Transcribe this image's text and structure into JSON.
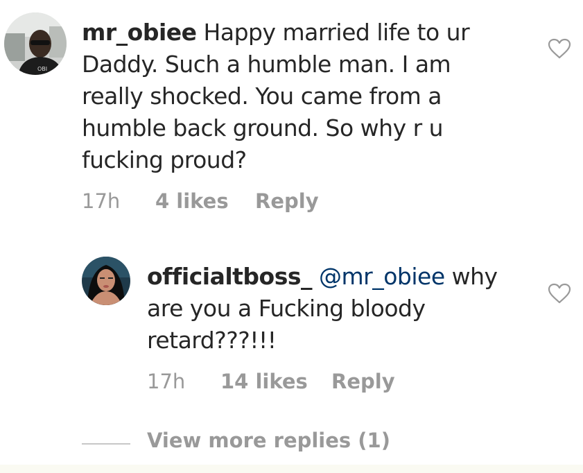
{
  "comments": [
    {
      "username": "mr_obiee",
      "text_lines": [
        "Happy married life to ur",
        "Daddy. Such a humble man. I am",
        "really shocked. You came from a",
        "humble back ground. So why r u",
        "fucking proud?"
      ],
      "time": "17h",
      "likes": "4 likes",
      "reply_label": "Reply",
      "avatar_icon": "profile-photo-man-sunglasses",
      "heart_icon": "heart-outline-icon"
    },
    {
      "username": "officialtboss_",
      "mention": "@mr_obiee",
      "text_lines": [
        "why",
        "are you a Fucking bloody",
        "retard???!!!"
      ],
      "time": "17h",
      "likes": "14 likes",
      "reply_label": "Reply",
      "avatar_icon": "profile-photo-woman",
      "heart_icon": "heart-outline-icon"
    }
  ],
  "view_more_replies": "View more replies (1)",
  "colors": {
    "text": "#262626",
    "muted": "#999999",
    "mention": "#003569",
    "bottom_bar": "#fafaf2"
  }
}
